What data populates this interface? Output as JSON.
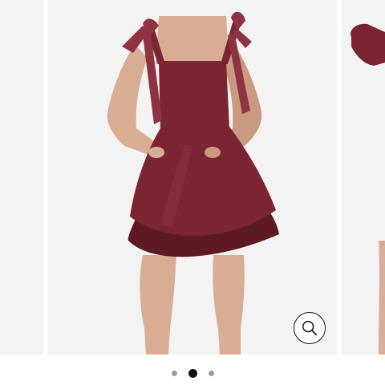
{
  "carousel": {
    "slides_total": 3,
    "active_slide": 2
  },
  "dress": {
    "color_main": "#7a2531",
    "color_shadow": "#5e1a24",
    "color_highlight": "#8e3341"
  },
  "skin": {
    "color": "#d9ad93",
    "shade": "#c99a80"
  },
  "background": {
    "color": "#f4f3f3"
  },
  "icons": {
    "zoom": "magnifier-icon"
  }
}
